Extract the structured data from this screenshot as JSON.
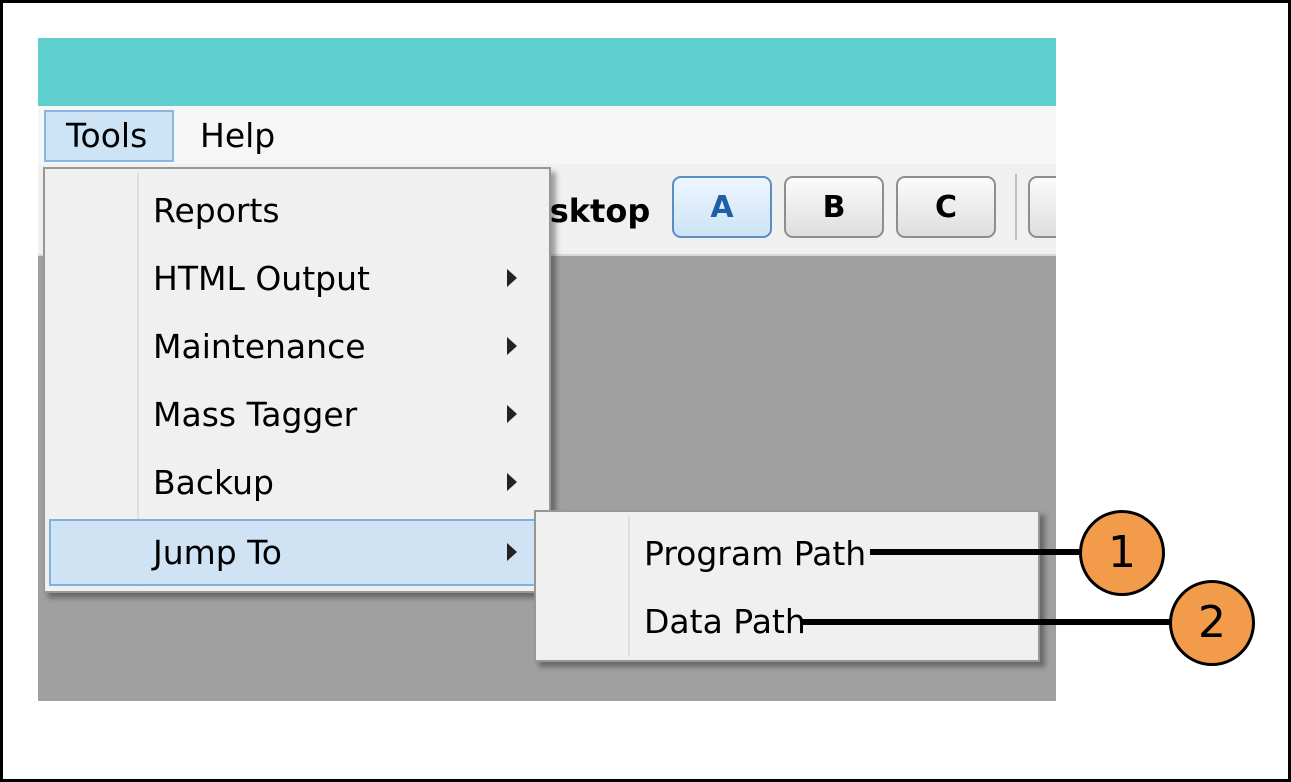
{
  "menubar": {
    "tools_label": "Tools",
    "help_label": "Help"
  },
  "toolbar": {
    "desktop_label": "esktop",
    "buttons": [
      "A",
      "B",
      "C"
    ],
    "active_button": "A"
  },
  "tools_menu": {
    "items": [
      {
        "label": "Reports",
        "has_submenu": false
      },
      {
        "label": "HTML Output",
        "has_submenu": true
      },
      {
        "label": "Maintenance",
        "has_submenu": true
      },
      {
        "label": "Mass Tagger",
        "has_submenu": true
      },
      {
        "label": "Backup",
        "has_submenu": true
      },
      {
        "label": "Jump To",
        "has_submenu": true,
        "highlighted": true
      }
    ]
  },
  "jump_to_submenu": {
    "items": [
      {
        "label": "Program Path"
      },
      {
        "label": "Data Path"
      }
    ]
  },
  "callouts": [
    {
      "number": "1"
    },
    {
      "number": "2"
    }
  ],
  "colors": {
    "titlebar": "#5ecfcc",
    "highlight": "#d0e3f5",
    "callout": "#f29b4b",
    "workspace": "#a0a0a0"
  }
}
